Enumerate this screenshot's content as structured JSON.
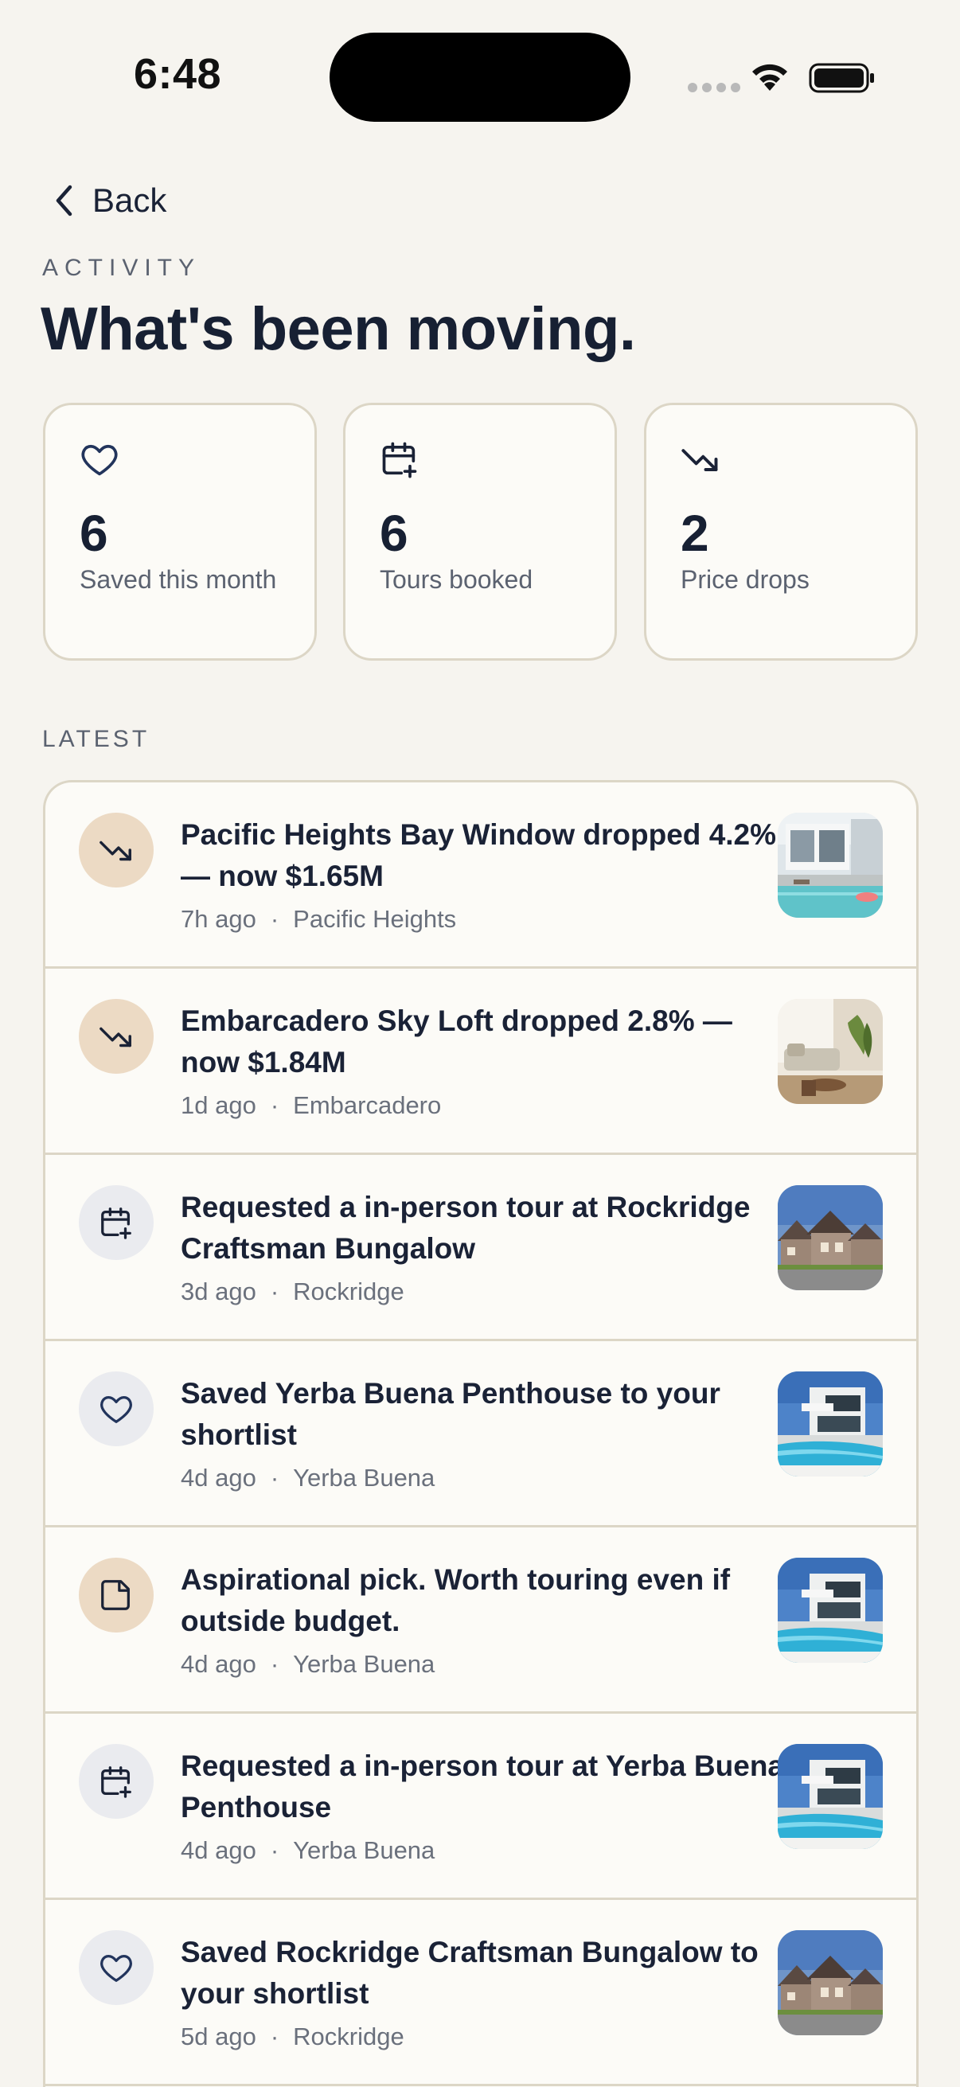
{
  "status_bar": {
    "time": "6:48"
  },
  "header": {
    "back_label": "Back",
    "eyebrow": "ACTIVITY",
    "title": "What's been moving."
  },
  "stats": [
    {
      "icon": "heart-icon",
      "value": "6",
      "label": "Saved this month"
    },
    {
      "icon": "calendar-plus-icon",
      "value": "6",
      "label": "Tours booked"
    },
    {
      "icon": "trending-down-icon",
      "value": "2",
      "label": "Price drops"
    }
  ],
  "section_label": "LATEST",
  "feed": [
    {
      "icon": "trending-down-icon",
      "title": "Pacific Heights Bay Window dropped 4.2% — now $1.65M",
      "time": "7h ago",
      "separator": "·",
      "location": "Pacific Heights",
      "thumbnail": "modern-house-pool-photo"
    },
    {
      "icon": "trending-down-icon",
      "title": "Embarcadero Sky Loft dropped 2.8% — now $1.84M",
      "time": "1d ago",
      "separator": "·",
      "location": "Embarcadero",
      "thumbnail": "living-room-photo"
    },
    {
      "icon": "calendar-plus-icon",
      "title": "Requested a in-person tour at Rockridge Craftsman Bungalow",
      "time": "3d ago",
      "separator": "·",
      "location": "Rockridge",
      "thumbnail": "suburban-houses-photo"
    },
    {
      "icon": "heart-icon",
      "title": "Saved Yerba Buena Penthouse to your shortlist",
      "time": "4d ago",
      "separator": "·",
      "location": "Yerba Buena",
      "thumbnail": "villa-pool-photo"
    },
    {
      "icon": "note-icon",
      "title": "Aspirational pick. Worth touring even if outside budget.",
      "time": "4d ago",
      "separator": "·",
      "location": "Yerba Buena",
      "thumbnail": "villa-pool-photo"
    },
    {
      "icon": "calendar-plus-icon",
      "title": "Requested a in-person tour at Yerba Buena Penthouse",
      "time": "4d ago",
      "separator": "·",
      "location": "Yerba Buena",
      "thumbnail": "villa-pool-photo"
    },
    {
      "icon": "heart-icon",
      "title": "Saved Rockridge Craftsman Bungalow to your shortlist",
      "time": "5d ago",
      "separator": "·",
      "location": "Rockridge",
      "thumbnail": "suburban-houses-photo"
    }
  ],
  "colors": {
    "background": "#f6f4ef",
    "card": "#fcfbf7",
    "border": "#dcd6c6",
    "ink": "#1a2236",
    "muted": "#5b6270",
    "drop_badge": "#ecdac4",
    "neutral_badge": "#eaebef"
  }
}
